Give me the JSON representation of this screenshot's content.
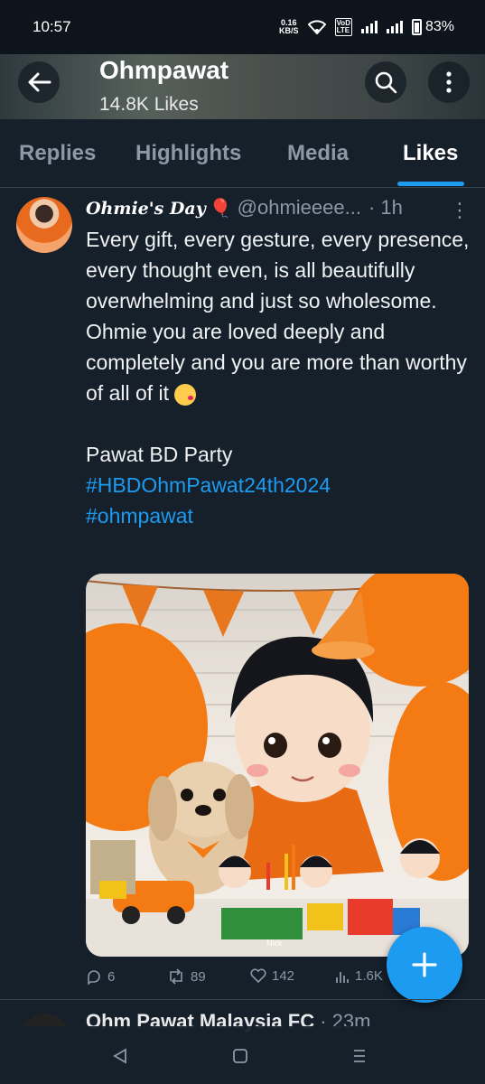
{
  "status_bar": {
    "time": "10:57",
    "net_speed": "0.16",
    "net_unit": "KB/S",
    "volte_top": "VoD",
    "volte_bottom": "LTE",
    "battery": "83%"
  },
  "header": {
    "title": "Ohmpawat",
    "subtitle": "14.8K Likes",
    "icons": [
      "back-arrow-icon",
      "search-icon",
      "more-vertical-icon"
    ]
  },
  "tabs": [
    {
      "label": "Replies",
      "active": false
    },
    {
      "label": "Highlights",
      "active": false
    },
    {
      "label": "Media",
      "active": false
    },
    {
      "label": "Likes",
      "active": true
    }
  ],
  "tweet": {
    "display_name": "Ohmie's Day",
    "name_emoji": "🎈",
    "handle": "@ohmieeee...",
    "time": "· 1h",
    "body": "Every gift, every gesture, every presence, every thought even, is all beautifully overwhelming and just so wholesome. Ohmie you are loved deeply and completely and you are more than worthy of all of it",
    "body2": "Pawat BD Party",
    "hashtags": [
      "#HBDOhmPawat24th2024",
      "#ohmpawat"
    ],
    "image_watermark": "Nick",
    "actions": {
      "replies": "6",
      "retweets": "89",
      "likes": "142",
      "views": "1.6K"
    }
  },
  "next_tweet": {
    "display_name": "Ohm Pawat Malaysia FC",
    "time": "· 23m"
  },
  "colors": {
    "background": "#15202b",
    "accent": "#1d9bf0",
    "muted": "#8b98a5",
    "divider": "#38444d"
  }
}
